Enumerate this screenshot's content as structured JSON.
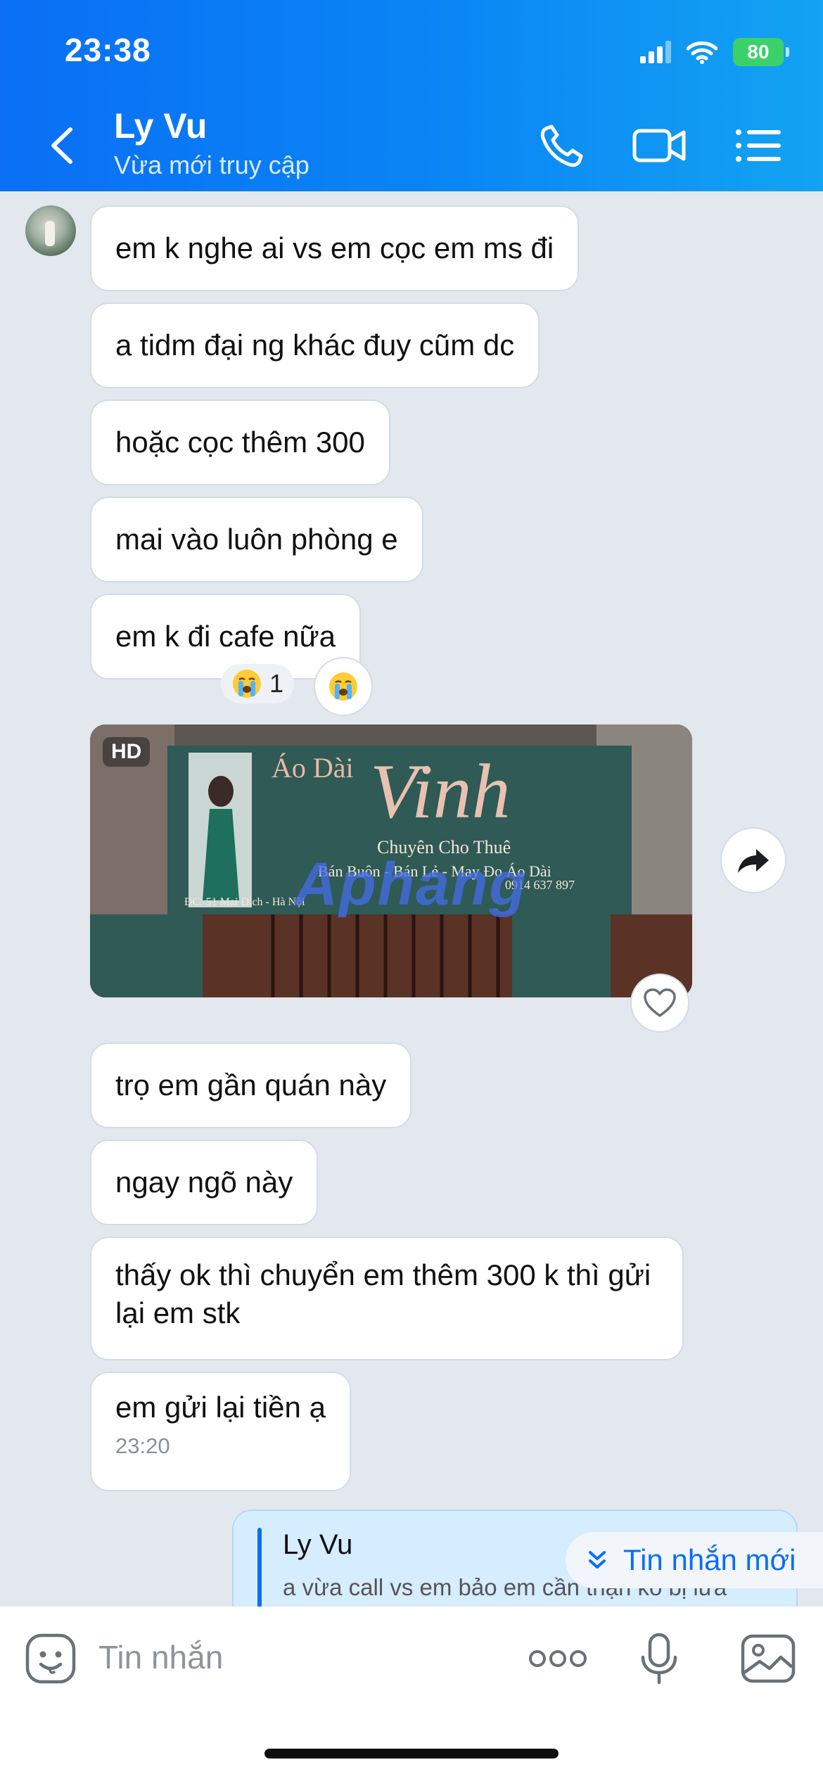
{
  "status_bar": {
    "time": "23:38",
    "battery": "80"
  },
  "header": {
    "name": "Ly Vu",
    "status": "Vừa mới truy cập"
  },
  "messages": [
    {
      "text": "em k nghe ai vs em cọc em ms đi"
    },
    {
      "text": "a tidm đại ng khác đuy cũm dc"
    },
    {
      "text": "hoặc cọc thêm 300"
    },
    {
      "text": "mai vào luôn phòng e"
    },
    {
      "text": "em k đi cafe nữa"
    },
    {
      "text": "trọ em gần quán này"
    },
    {
      "text": "ngay ngõ này"
    },
    {
      "text": "thấy ok thì chuyển em thêm 300 k thì gửi lại em stk"
    },
    {
      "text": "em gửi lại tiền ạ",
      "time": "23:20"
    }
  ],
  "reaction": {
    "count": "1",
    "emoji": "crying-face"
  },
  "photo": {
    "badge": "HD",
    "sign_brand": "Áo Dài",
    "sign_name": "Vinh",
    "sign_sub": "Chuyên Cho Thuê",
    "sign_line2": "Bán Buôn - Bán Lẻ - May Đo Áo Dài",
    "sign_address": "ĐC: 51 Mai Dịch - Hà Nội",
    "sign_phone": "0914 637 897",
    "watermark": "Aphang"
  },
  "quote": {
    "name": "Ly Vu",
    "text": "a vừa call vs em bảo em cần thận ko bị lừa"
  },
  "new_message_label": "Tin nhắn mới",
  "input": {
    "placeholder": "Tin nhắn"
  },
  "colors": {
    "accent": "#0a6ff5",
    "chat_bg": "#e3e8ef",
    "header_gradient_end": "#13a3f2"
  }
}
